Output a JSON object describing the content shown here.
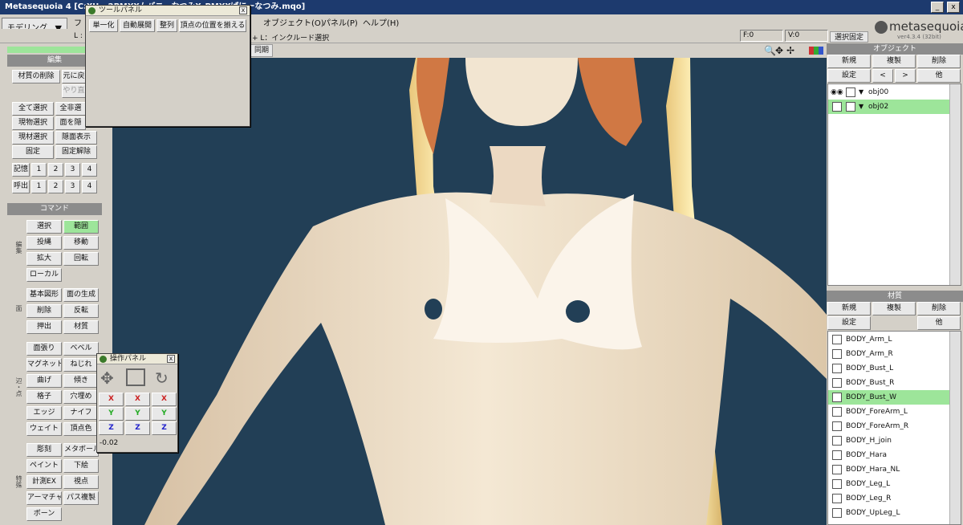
{
  "window": {
    "title": "Metasequoia 4 [C:¥U...2PMX¥ムバニーなつみ¥_PMX¥ばにーなつみ.mqo]",
    "min": "_",
    "close": "x"
  },
  "menubar": {
    "mode": "モデリング",
    "items": [
      "オブジェクト(O)",
      "パネル(P)",
      "ヘルプ(H)"
    ],
    "partial_f": "フ"
  },
  "statusbar": {
    "hint": "+ L：インクルード選択",
    "l_label": "L :",
    "f": "F:0",
    "v": "V:0",
    "lock": "選択固定",
    "sync": "同期"
  },
  "logo": {
    "name": "metasequoia",
    "num": "4",
    "version": "ver4.3.4 (32bit)"
  },
  "edit": {
    "header": "編集",
    "buttons": [
      [
        "材質の削除",
        "元に戻"
      ],
      [
        "",
        "やり直"
      ],
      [
        "全て選択",
        "全非選"
      ],
      [
        "現物選択",
        "面を隠"
      ],
      [
        "現材選択",
        "隠面表示"
      ],
      [
        "固定",
        "固定解除"
      ]
    ],
    "mem_label": "記憶",
    "call_label": "呼出",
    "nums": [
      "1",
      "2",
      "3",
      "4"
    ]
  },
  "command": {
    "header": "コマンド",
    "edit_label": "編集",
    "face_label": "面",
    "edge_label": "辺・点",
    "special_label": "特殊",
    "g1": [
      [
        "選択",
        "範囲"
      ],
      [
        "投縄",
        "移動"
      ],
      [
        "拡大",
        "回転"
      ],
      [
        "ローカル",
        ""
      ]
    ],
    "g2": [
      [
        "基本図形",
        "面の生成"
      ],
      [
        "削除",
        "反転"
      ],
      [
        "押出",
        "材質"
      ]
    ],
    "g3": [
      [
        "面張り",
        "ベベル"
      ],
      [
        "マグネット",
        "ねじれ"
      ],
      [
        "曲げ",
        "傾き"
      ],
      [
        "格子",
        "穴埋め"
      ],
      [
        "エッジ",
        "ナイフ"
      ],
      [
        "ウェイト",
        "頂点色"
      ]
    ],
    "g4": [
      [
        "彫刻",
        "メタボール"
      ],
      [
        "ペイント",
        "下絵"
      ],
      [
        "計測EX",
        "視点"
      ],
      [
        "アーマチャー",
        "パス複製"
      ],
      [
        "ボーン",
        ""
      ]
    ]
  },
  "tool_panel": {
    "title": "ツールパネル",
    "buttons": [
      "単一化",
      "自動展開",
      "整列",
      "頂点の位置を揃える"
    ],
    "close": "x"
  },
  "op_panel": {
    "title": "操作パネル",
    "close": "x",
    "axes": [
      "X",
      "Y",
      "Z"
    ],
    "value": "-0.02"
  },
  "object_panel": {
    "title": "オブジェクト",
    "new": "新規",
    "copy": "複製",
    "delete": "削除",
    "settings": "設定",
    "prev": "<",
    "next": ">",
    "other": "他",
    "objects": [
      "obj00",
      "obj02"
    ],
    "selected": "obj02"
  },
  "material_panel": {
    "title": "材質",
    "new": "新規",
    "copy": "複製",
    "delete": "削除",
    "settings": "設定",
    "other": "他",
    "materials": [
      "BODY_Arm_L",
      "BODY_Arm_R",
      "BODY_Bust_L",
      "BODY_Bust_R",
      "BODY_Bust_W",
      "BODY_ForeArm_L",
      "BODY_ForeArm_R",
      "BODY_H_join",
      "BODY_Hara",
      "BODY_Hara_NL",
      "BODY_Leg_L",
      "BODY_Leg_R",
      "BODY_UpLeg_L"
    ],
    "selected": "BODY_Bust_W"
  },
  "colors": {
    "viewport_bg": "#223f56",
    "selected": "#9de59a",
    "titlebar": "#1d3a6e"
  }
}
